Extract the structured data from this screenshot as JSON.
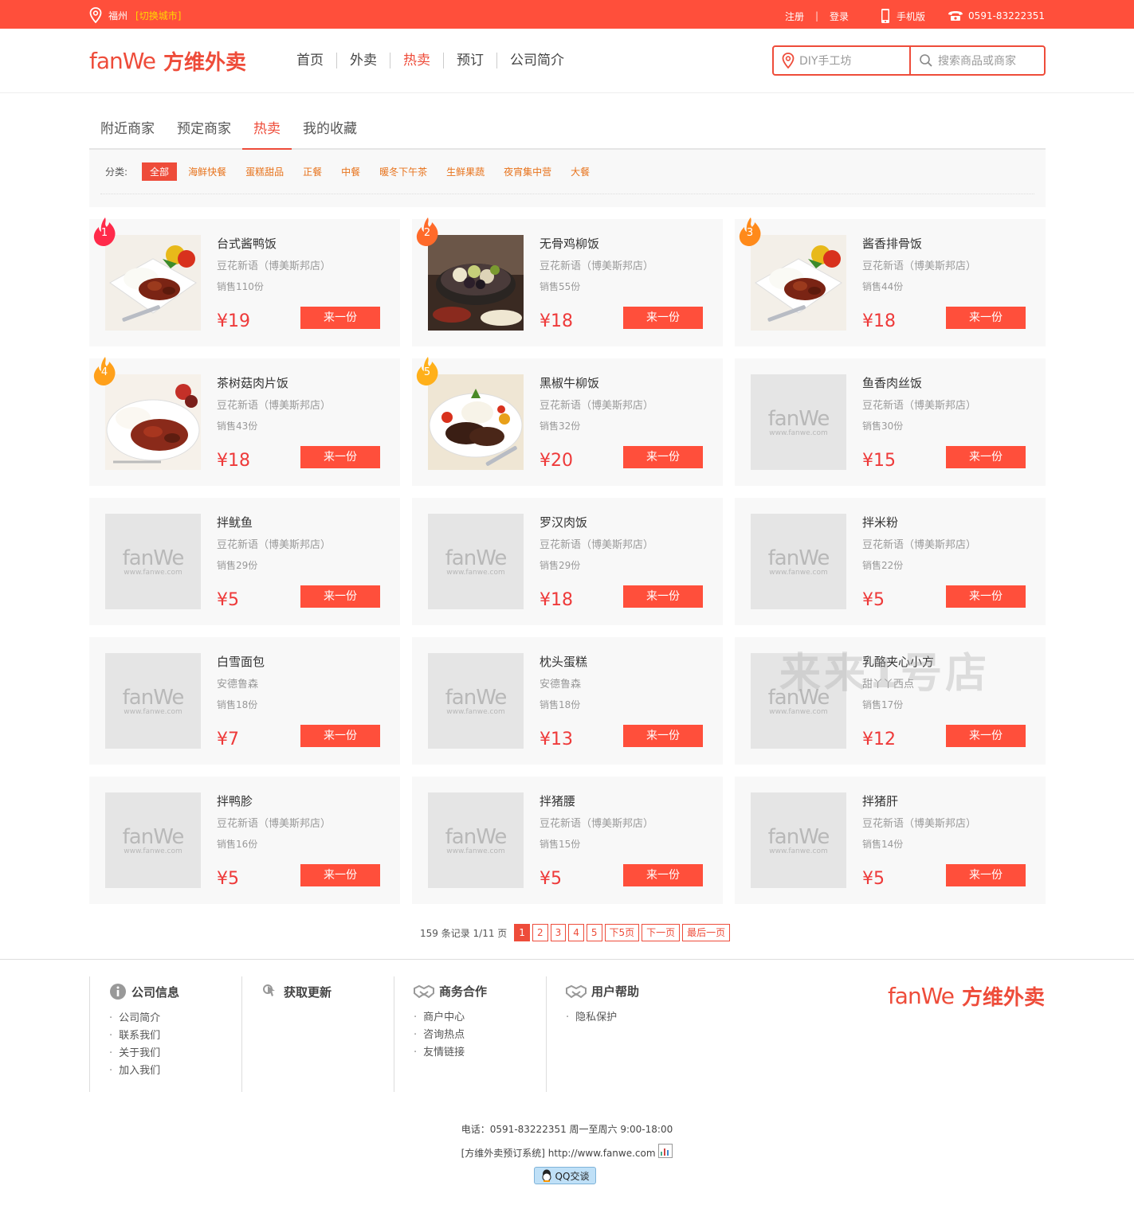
{
  "topbar": {
    "city": "福州",
    "switch_city": "[切换城市]",
    "register": "注册",
    "login": "登录",
    "mobile": "手机版",
    "phone": "0591-83222351",
    "bg_color": "#ff4f3b"
  },
  "header": {
    "logo_en": "fanWe",
    "logo_cn": "方维外卖",
    "nav": [
      "首页",
      "外卖",
      "热卖",
      "预订",
      "公司简介"
    ],
    "nav_active": "热卖",
    "search_location": "DIY手工坊",
    "search_placeholder": "搜索商品或商家",
    "accent": "#ee4c3a"
  },
  "tabs": [
    "附近商家",
    "预定商家",
    "热卖",
    "我的收藏"
  ],
  "categories": {
    "label": "分类:",
    "items": [
      "全部",
      "海鲜快餐",
      "蛋糕甜品",
      "正餐",
      "中餐",
      "暖冬下午茶",
      "生鲜果蔬",
      "夜宵集中营",
      "大餐"
    ]
  },
  "placeholder": {
    "en": "fanWe",
    "url": "www.fanwe.com"
  },
  "buy_label": "来一份",
  "products": [
    {
      "name": "台式酱鸭饭",
      "shop": "豆花新语（博美斯邦店）",
      "sales": "销售110份",
      "price": "¥19",
      "rank": "1",
      "photo": "rice"
    },
    {
      "name": "无骨鸡柳饭",
      "shop": "豆花新语（博美斯邦店）",
      "sales": "销售55份",
      "price": "¥18",
      "rank": "2",
      "photo": "bowl"
    },
    {
      "name": "酱香排骨饭",
      "shop": "豆花新语（博美斯邦店）",
      "sales": "销售44份",
      "price": "¥18",
      "rank": "3",
      "photo": "rice"
    },
    {
      "name": "茶树菇肉片饭",
      "shop": "豆花新语（博美斯邦店）",
      "sales": "销售43份",
      "price": "¥18",
      "rank": "4",
      "photo": "stew"
    },
    {
      "name": "黑椒牛柳饭",
      "shop": "豆花新语（博美斯邦店）",
      "sales": "销售32份",
      "price": "¥20",
      "rank": "5",
      "photo": "beef"
    },
    {
      "name": "鱼香肉丝饭",
      "shop": "豆花新语（博美斯邦店）",
      "sales": "销售30份",
      "price": "¥15"
    },
    {
      "name": "拌鱿鱼",
      "shop": "豆花新语（博美斯邦店）",
      "sales": "销售29份",
      "price": "¥5"
    },
    {
      "name": "罗汉肉饭",
      "shop": "豆花新语（博美斯邦店）",
      "sales": "销售29份",
      "price": "¥18"
    },
    {
      "name": "拌米粉",
      "shop": "豆花新语（博美斯邦店）",
      "sales": "销售22份",
      "price": "¥5"
    },
    {
      "name": "白雪面包",
      "shop": "安德鲁森",
      "sales": "销售18份",
      "price": "¥7"
    },
    {
      "name": "枕头蛋糕",
      "shop": "安德鲁森",
      "sales": "销售18份",
      "price": "¥13"
    },
    {
      "name": "乳酪夹心小方",
      "shop": "甜丫丫西点",
      "sales": "销售17份",
      "price": "¥12"
    },
    {
      "name": "拌鸭胗",
      "shop": "豆花新语（博美斯邦店）",
      "sales": "销售16份",
      "price": "¥5"
    },
    {
      "name": "拌猪腰",
      "shop": "豆花新语（博美斯邦店）",
      "sales": "销售15份",
      "price": "¥5"
    },
    {
      "name": "拌猪肝",
      "shop": "豆花新语（博美斯邦店）",
      "sales": "销售14份",
      "price": "¥5"
    }
  ],
  "watermark": "来来1号店",
  "pager": {
    "info": "159 条记录 1/11 页",
    "pages": [
      "1",
      "2",
      "3",
      "4",
      "5"
    ],
    "next5": "下5页",
    "next": "下一页",
    "last": "最后一页"
  },
  "footer": {
    "cols": [
      {
        "title": "公司信息",
        "icon": "info-icon",
        "items": [
          "公司简介",
          "联系我们",
          "关于我们",
          "加入我们"
        ]
      },
      {
        "title": "获取更新",
        "icon": "update-icon",
        "items": []
      },
      {
        "title": "商务合作",
        "icon": "handshake-icon",
        "items": [
          "商户中心",
          "咨询热点",
          "友情链接"
        ]
      },
      {
        "title": "用户帮助",
        "icon": "handshake-icon",
        "items": [
          "隐私保护"
        ]
      }
    ],
    "logo_en": "fanWe",
    "logo_cn": "方维外卖",
    "tel": "电话：0591-83222351 周一至周六 9:00-18:00",
    "site": "[方维外卖预订系统] http://www.fanwe.com",
    "qq": "QQ交谈"
  }
}
